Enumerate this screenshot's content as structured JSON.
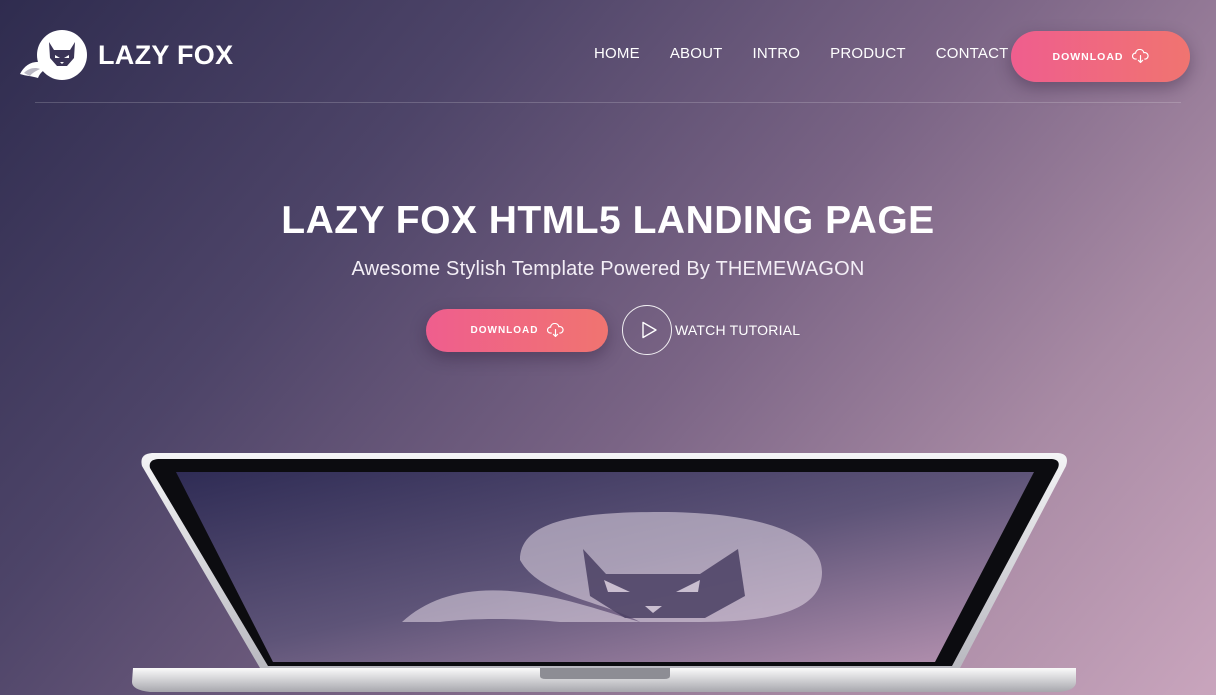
{
  "brand": {
    "name": "LAZY FOX",
    "logo_icon": "fox-logo-icon"
  },
  "nav": {
    "items": [
      {
        "label": "HOME"
      },
      {
        "label": "ABOUT"
      },
      {
        "label": "INTRO"
      },
      {
        "label": "PRODUCT"
      },
      {
        "label": "CONTACT"
      }
    ],
    "download": {
      "label": "DOWNLOAD",
      "icon": "cloud-download-icon"
    }
  },
  "hero": {
    "title": "LAZY FOX HTML5 LANDING PAGE",
    "subtitle": "Awesome Stylish Template Powered By THEMEWAGON",
    "download": {
      "label": "DOWNLOAD",
      "icon": "cloud-download-icon"
    },
    "watch": {
      "label": "WATCH TUTORIAL",
      "icon": "play-icon"
    }
  },
  "colors": {
    "accent_start": "#ef5e8e",
    "accent_end": "#f07470",
    "bg_dark": "#2f2c4f",
    "bg_light": "#c9a5bd"
  }
}
